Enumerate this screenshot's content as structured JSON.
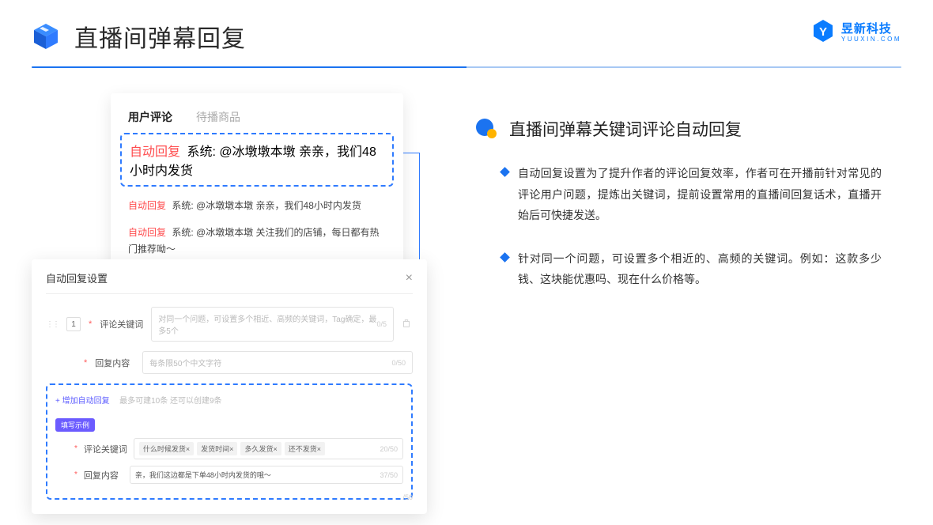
{
  "header": {
    "title": "直播间弹幕回复",
    "logo_cn": "昱新科技",
    "logo_en": "YUUXIN.COM"
  },
  "comments": {
    "tab_active": "用户评论",
    "tab_inactive": "待播商品",
    "rows": [
      {
        "tag": "自动回复",
        "text": "系统: @冰墩墩本墩 亲亲，我们48小时内发货"
      },
      {
        "tag": "自动回复",
        "text": "系统: @冰墩墩本墩 亲亲，我们48小时内发货"
      },
      {
        "tag": "自动回复",
        "text": "系统: @冰墩墩本墩 关注我们的店铺，每日都有热门推荐呦～"
      }
    ]
  },
  "settings": {
    "title": "自动回复设置",
    "index": "1",
    "kw_label": "评论关键词",
    "kw_placeholder": "对同一个问题，可设置多个相近、高频的关键词，Tag确定，最多5个",
    "kw_counter": "0/5",
    "content_label": "回复内容",
    "content_placeholder": "每条限50个中文字符",
    "content_counter": "0/50",
    "add_link": "+ 增加自动回复",
    "add_hint": "最多可建10条 还可以创建9条",
    "example_badge": "填写示例",
    "ex_kw_label": "评论关键词",
    "ex_tags": [
      "什么时候发货×",
      "发货时间×",
      "多久发货×",
      "还不发货×"
    ],
    "ex_kw_counter": "20/50",
    "ex_content_label": "回复内容",
    "ex_content_value": "亲，我们这边都是下单48小时内发货的哦～",
    "ex_content_counter": "37/50",
    "final_counter": "/50"
  },
  "right": {
    "section_title": "直播间弹幕关键词评论自动回复",
    "bullets": [
      "自动回复设置为了提升作者的评论回复效率，作者可在开播前针对常见的评论用户问题，提炼出关键词，提前设置常用的直播间回复话术，直播开始后可快捷发送。",
      "针对同一个问题，可设置多个相近的、高频的关键词。例如：这款多少钱、这块能优惠吗、现在什么价格等。"
    ]
  }
}
